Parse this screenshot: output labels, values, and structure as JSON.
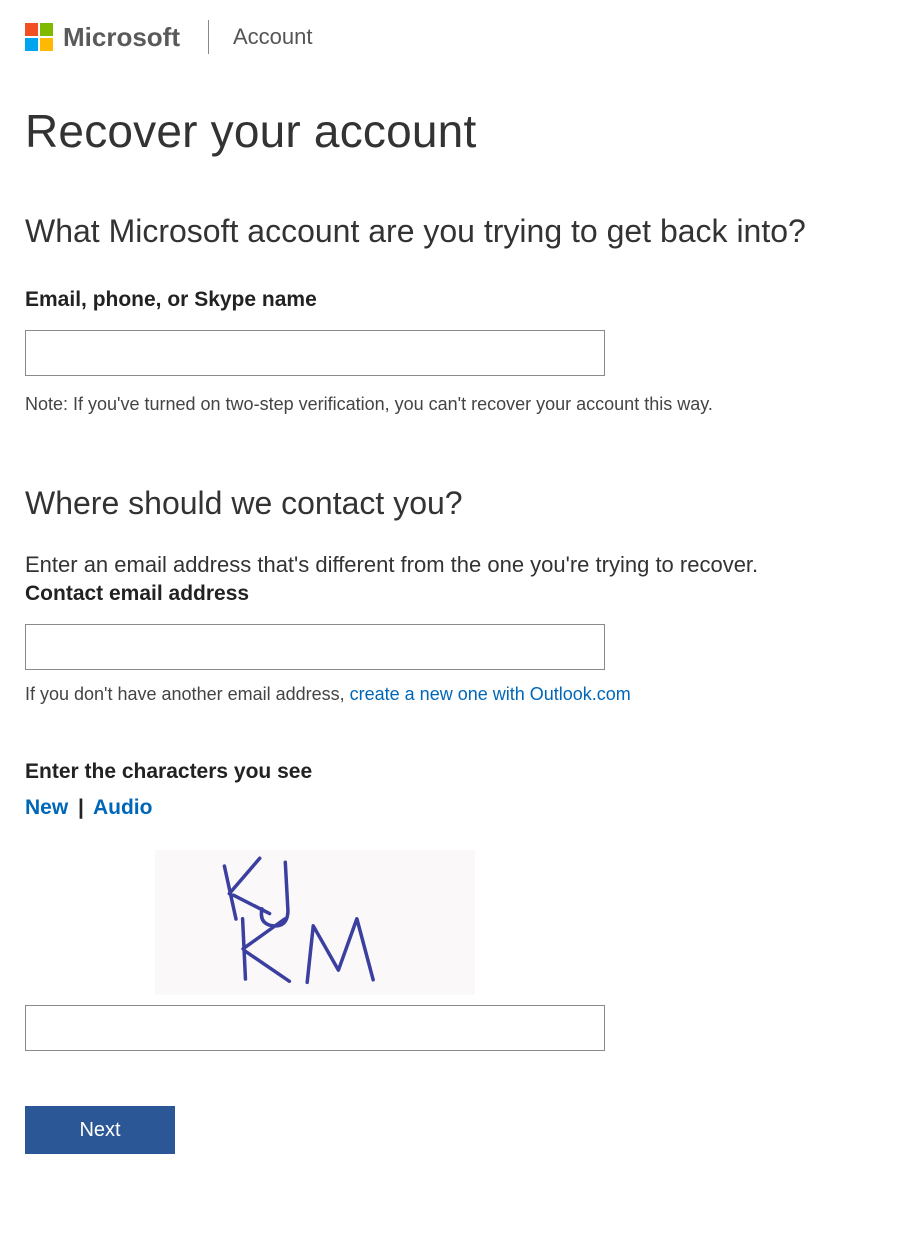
{
  "header": {
    "brand": "Microsoft",
    "sub": "Account"
  },
  "page": {
    "title": "Recover your account"
  },
  "section_account": {
    "heading": "What Microsoft account are you trying to get back into?",
    "field_label": "Email, phone, or Skype name",
    "note": "Note: If you've turned on two-step verification, you can't recover your account this way."
  },
  "section_contact": {
    "heading": "Where should we contact you?",
    "desc": "Enter an email address that's different from the one you're trying to recover.",
    "field_label": "Contact email address",
    "hint_prefix": "If you don't have another email address, ",
    "hint_link": "create a new one with Outlook.com"
  },
  "section_captcha": {
    "label": "Enter the characters you see",
    "new": "New",
    "sep": "|",
    "audio": "Audio",
    "image_alt": "CAPTCHA image showing distorted letters K J K M"
  },
  "actions": {
    "next": "Next"
  }
}
